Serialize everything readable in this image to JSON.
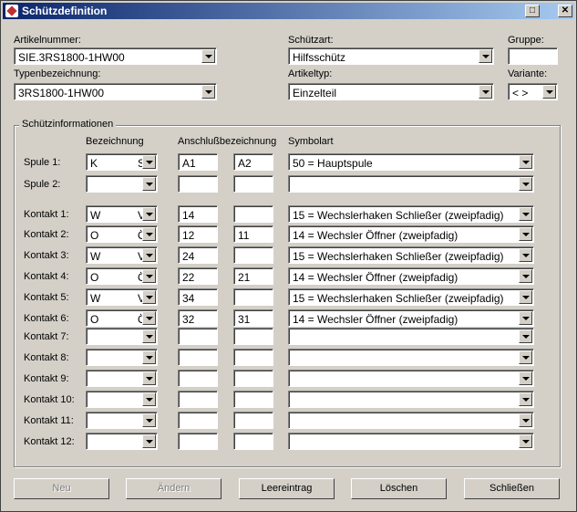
{
  "window": {
    "title": "Schützdefinition"
  },
  "top": {
    "artikelnummer_label": "Artikelnummer:",
    "artikelnummer_value": "SIE.3RS1800-1HW00",
    "typenbezeichnung_label": "Typenbezeichnung:",
    "typenbezeichnung_value": "3RS1800-1HW00",
    "schuetzart_label": "Schützart:",
    "schuetzart_value": "Hilfsschütz",
    "artikeltyp_label": "Artikeltyp:",
    "artikeltyp_value": "Einzelteil",
    "gruppe_label": "Gruppe:",
    "gruppe_value": "",
    "variante_label": "Variante:",
    "variante_value": "< >"
  },
  "group": {
    "label": "Schützinformationen",
    "col_bezeichnung": "Bezeichnung",
    "col_anschluss": "Anschlußbezeichnung",
    "col_symbolart": "Symbolart"
  },
  "rows": [
    {
      "label": "Spule 1:",
      "bez": "K",
      "bez2": "S",
      "a1": "A1",
      "a2": "A2",
      "sym": "50 = Hauptspule"
    },
    {
      "label": "Spule 2:",
      "bez": "",
      "bez2": "",
      "a1": "",
      "a2": "",
      "sym": ""
    },
    {
      "label": "Kontakt 1:",
      "bez": "W",
      "bez2": "V",
      "a1": "14",
      "a2": "",
      "sym": "15 = Wechslerhaken Schließer (zweipfadig)"
    },
    {
      "label": "Kontakt 2:",
      "bez": "O",
      "bez2": "Ö",
      "a1": "12",
      "a2": "11",
      "sym": "14 = Wechsler Öffner (zweipfadig)"
    },
    {
      "label": "Kontakt 3:",
      "bez": "W",
      "bez2": "V",
      "a1": "24",
      "a2": "",
      "sym": "15 = Wechslerhaken Schließer (zweipfadig)"
    },
    {
      "label": "Kontakt 4:",
      "bez": "O",
      "bez2": "Ö",
      "a1": "22",
      "a2": "21",
      "sym": "14 = Wechsler Öffner (zweipfadig)"
    },
    {
      "label": "Kontakt 5:",
      "bez": "W",
      "bez2": "V",
      "a1": "34",
      "a2": "",
      "sym": "15 = Wechslerhaken Schließer (zweipfadig)"
    },
    {
      "label": "Kontakt 6:",
      "bez": "O",
      "bez2": "Ö",
      "a1": "32",
      "a2": "31",
      "sym": "14 = Wechsler Öffner (zweipfadig)"
    },
    {
      "label": "Kontakt 7:",
      "bez": "",
      "bez2": "",
      "a1": "",
      "a2": "",
      "sym": ""
    },
    {
      "label": "Kontakt 8:",
      "bez": "",
      "bez2": "",
      "a1": "",
      "a2": "",
      "sym": ""
    },
    {
      "label": "Kontakt 9:",
      "bez": "",
      "bez2": "",
      "a1": "",
      "a2": "",
      "sym": ""
    },
    {
      "label": "Kontakt 10:",
      "bez": "",
      "bez2": "",
      "a1": "",
      "a2": "",
      "sym": ""
    },
    {
      "label": "Kontakt 11:",
      "bez": "",
      "bez2": "",
      "a1": "",
      "a2": "",
      "sym": ""
    },
    {
      "label": "Kontakt 12:",
      "bez": "",
      "bez2": "",
      "a1": "",
      "a2": "",
      "sym": ""
    }
  ],
  "buttons": {
    "neu": "Neu",
    "aendern": "Ändern",
    "leereintrag": "Leereintrag",
    "loeschen": "Löschen",
    "schliessen": "Schließen"
  }
}
